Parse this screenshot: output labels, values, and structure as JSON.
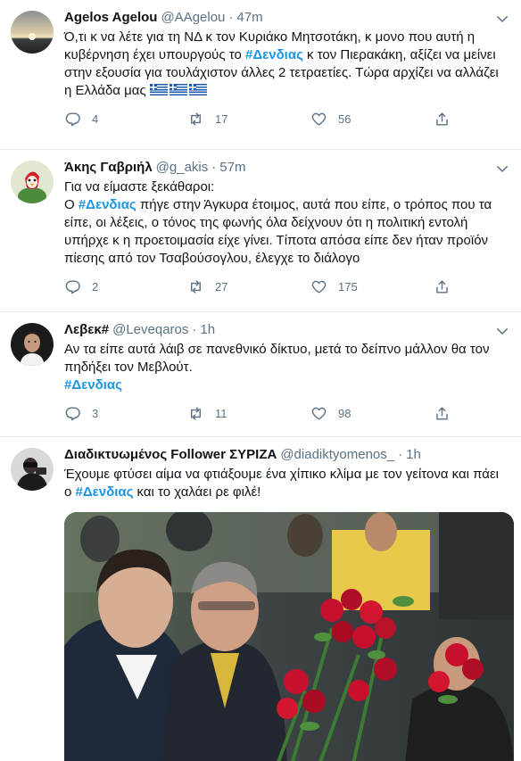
{
  "tweets": [
    {
      "name": "Agelos Agelou",
      "handle": "@AAgelou",
      "separator": "·",
      "time": "47m",
      "text_1": "Ό,τι κ να λέτε για τη ΝΔ κ τον Κυριάκο Μητσοτάκη, κ μονο που αυτή η κυβέρνηση έχει υπουργούς το ",
      "hashtag": "#Δενδιας",
      "text_2": " κ τον Πιερακάκη, αξίζει να μείνει στην εξουσία για τουλάχιστον άλλες 2 τετραετίες. Τώρα αρχίζει να αλλάζει η Ελλάδα μας ",
      "emoji": "flag-greece ×3",
      "replies": "4",
      "retweets": "17",
      "likes": "56"
    },
    {
      "name": "Άκης Γαβριήλ",
      "handle": "@g_akis",
      "separator": "·",
      "time": "57m",
      "text_1": "Για να είμαστε ξεκάθαροι:",
      "text_2": "Ο ",
      "hashtag": "#Δενδιας",
      "text_3": " πήγε στην Άγκυρα έτοιμος, αυτά που είπε, ο τρόπος που τα είπε, οι λέξεις, ο τόνος της φωνής όλα δείχνουν ότι η πολιτική εντολή υπήρχε κ η προετοιμασία είχε γίνει. Τίποτα απόσα είπε δεν ήταν προϊόν πίεσης από τον Τσαβούσογλου, έλεγχε το διάλογο",
      "replies": "2",
      "retweets": "27",
      "likes": "175"
    },
    {
      "name": "Λεβεκ#",
      "handle": "@Leveqaros",
      "separator": "·",
      "time": "1h",
      "text_1": "Αν τα είπε αυτά λάιβ σε πανεθνικό δίκτυο, μετά το δείπνο μάλλον θα τον πηδήξει τον Μεβλούτ.",
      "hashtag": "#Δενδιας",
      "replies": "3",
      "retweets": "11",
      "likes": "98"
    },
    {
      "name": "Διαδικτυωμένος Follower ΣΥΡΙΖΑ",
      "handle": "@diadiktyomenos_",
      "separator": "·",
      "time": "1h",
      "text_1": "Έχουμε φτύσει αίμα να φτιάξουμε ένα χίπικο κλίμα με τον γείτονα και πάει ο ",
      "hashtag": "#Δενδιας",
      "text_2": " και το χαλάει ρε φιλέ!"
    }
  ],
  "colors": {
    "text": "#0f1419",
    "secondary": "#5b7083",
    "hashtag": "#1b95e0",
    "divider": "#e6ecf0",
    "rose": "#c8102e"
  }
}
